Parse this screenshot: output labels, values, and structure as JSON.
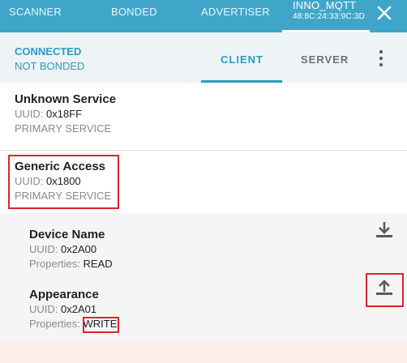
{
  "top_tabs": {
    "scanner": "SCANNER",
    "bonded": "BONDED",
    "advertiser": "ADVERTISER",
    "device_name": "INNO_MQTT",
    "device_address": "48:8C:24:33:9C:3D"
  },
  "connection": {
    "status": "CONNECTED",
    "bond_state": "NOT BONDED"
  },
  "sub_tabs": {
    "client": "CLIENT",
    "server": "SERVER"
  },
  "services": [
    {
      "name": "Unknown Service",
      "uuid_label": "UUID: ",
      "uuid": "0x18FF",
      "type": "PRIMARY SERVICE"
    },
    {
      "name": "Generic Access",
      "uuid_label": "UUID: ",
      "uuid": "0x1800",
      "type": "PRIMARY SERVICE"
    }
  ],
  "characteristics": [
    {
      "name": "Device Name",
      "uuid_label": "UUID: ",
      "uuid": "0x2A00",
      "props_label": "Properties: ",
      "props": "READ",
      "action_icon": "download-icon"
    },
    {
      "name": "Appearance",
      "uuid_label": "UUID: ",
      "uuid": "0x2A01",
      "props_label": "Properties: ",
      "props": "WRITE",
      "action_icon": "upload-icon"
    }
  ],
  "colors": {
    "topbar": "#3fa6c9",
    "accent": "#2a9cc2",
    "highlight": "#d9262b"
  }
}
